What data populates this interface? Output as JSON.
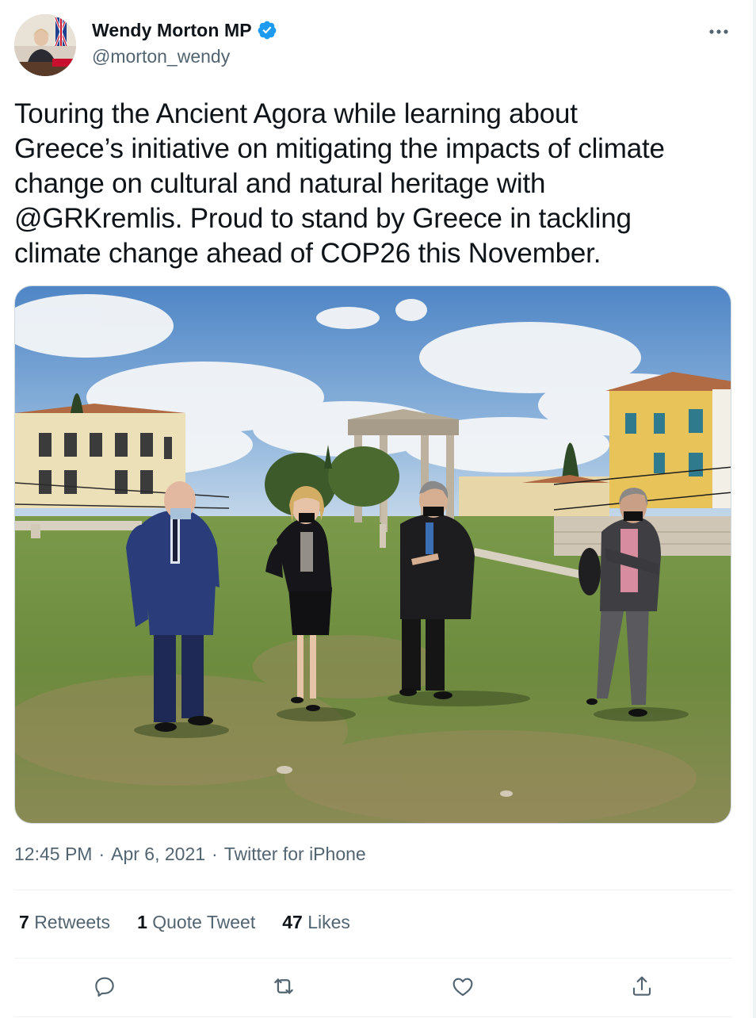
{
  "author": {
    "name": "Wendy Morton MP",
    "handle": "@morton_wendy",
    "verified": true,
    "verified_icon": "verified-badge-icon"
  },
  "tweet": {
    "text": "Touring the Ancient Agora while learning about\nGreece’s initiative on mitigating the impacts of climate\nchange on cultural and natural heritage with\n@GRKremlis. Proud to stand by Greece in tackling\nclimate change ahead of COP26 this November.",
    "time": "12:45 PM",
    "separator": "·",
    "date": "Apr 6, 2021",
    "source": "Twitter for iPhone"
  },
  "stats": {
    "retweets_count": "7",
    "retweets_label": "Retweets",
    "quotes_count": "1",
    "quotes_label": "Quote Tweet",
    "likes_count": "47",
    "likes_label": "Likes"
  },
  "actions": [
    "reply-icon",
    "retweet-icon",
    "like-icon",
    "share-icon"
  ],
  "colors": {
    "text_primary": "#0f1419",
    "text_secondary": "#536471",
    "verified_blue": "#1d9bf0",
    "divider": "#eff3f4"
  }
}
